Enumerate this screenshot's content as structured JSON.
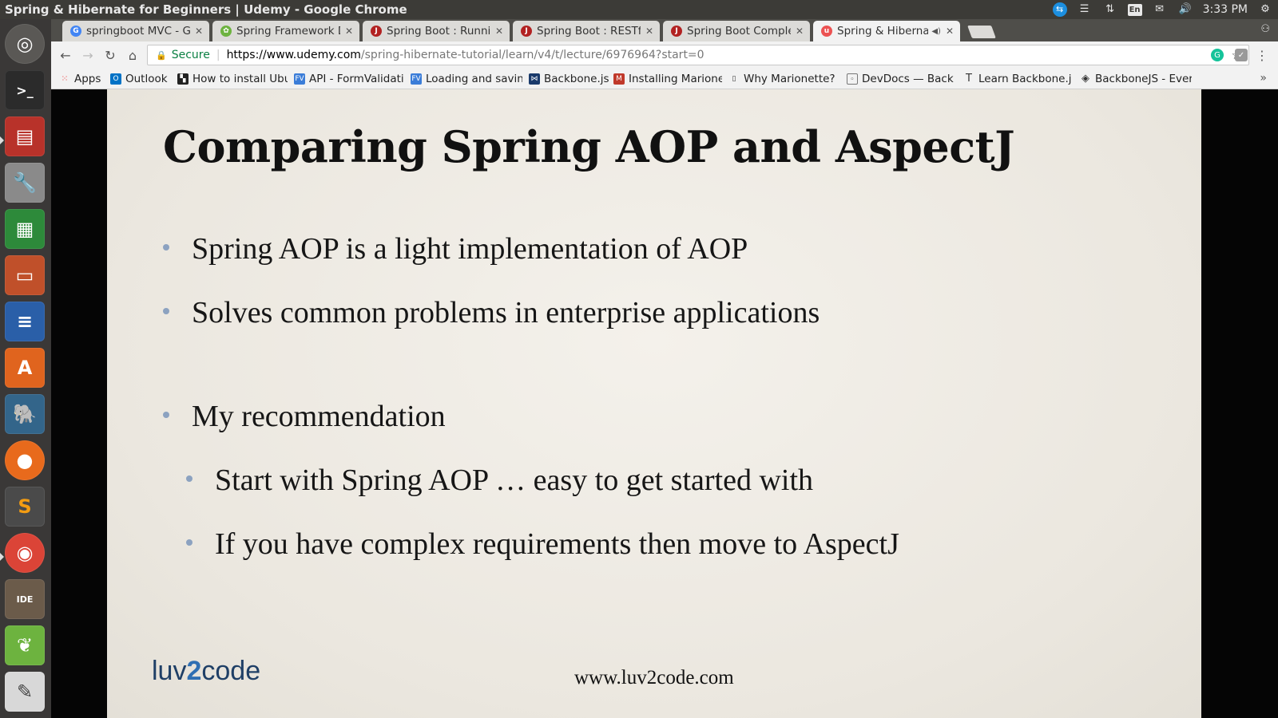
{
  "window": {
    "title": "Spring & Hibernate for Beginners | Udemy - Google Chrome"
  },
  "system_tray": {
    "language": "En",
    "clock": "3:33 PM"
  },
  "tabs": [
    {
      "label": "springboot MVC - Go",
      "favicon": "google-icon",
      "favicon_color": "#4285f4"
    },
    {
      "label": "Spring Framework D",
      "favicon": "spring-leaf-icon",
      "favicon_color": "#6db33f"
    },
    {
      "label": "Spring Boot : Runnin",
      "favicon": "jb-icon",
      "favicon_color": "#b22222"
    },
    {
      "label": "Spring Boot : RESTfu",
      "favicon": "jb-icon",
      "favicon_color": "#b22222"
    },
    {
      "label": "Spring Boot Complet",
      "favicon": "jb-icon",
      "favicon_color": "#b22222"
    },
    {
      "label": "Spring & Hibernat",
      "favicon": "udemy-icon",
      "favicon_color": "#ec5252",
      "active": true
    }
  ],
  "address": {
    "secure_label": "Secure",
    "url_host": "https://www.udemy.com",
    "url_path": "/spring-hibernate-tutorial/learn/v4/t/lecture/6976964?start=0"
  },
  "bookmarks": [
    {
      "label": "Apps",
      "icon": "apps-grid-icon"
    },
    {
      "label": "Outlook",
      "icon": "outlook-icon"
    },
    {
      "label": "How to install Ubu",
      "icon": "page-icon"
    },
    {
      "label": "API - FormValidati",
      "icon": "fv-icon"
    },
    {
      "label": "Loading and savin",
      "icon": "fv-icon"
    },
    {
      "label": "Backbone.js",
      "icon": "backbone-icon"
    },
    {
      "label": "Installing Marione",
      "icon": "marionette-icon"
    },
    {
      "label": "Why Marionette?",
      "icon": "book-icon"
    },
    {
      "label": "DevDocs — Backb",
      "icon": "devdocs-icon"
    },
    {
      "label": "Learn Backbone.js",
      "icon": "text-icon"
    },
    {
      "label": "BackboneJS - Ever",
      "icon": "diamond-icon"
    }
  ],
  "slide": {
    "title": "Comparing Spring AOP and AspectJ",
    "bullets": [
      "Spring AOP is a light implementation of AOP",
      "Solves common problems in enterprise applications",
      "My recommendation"
    ],
    "sub_bullets": [
      "Start with Spring AOP … easy to get started with",
      "If you have complex requirements then move to AspectJ"
    ],
    "logo_left": "luv",
    "logo_mid": "2",
    "logo_right": "code",
    "website": "www.luv2code.com"
  }
}
